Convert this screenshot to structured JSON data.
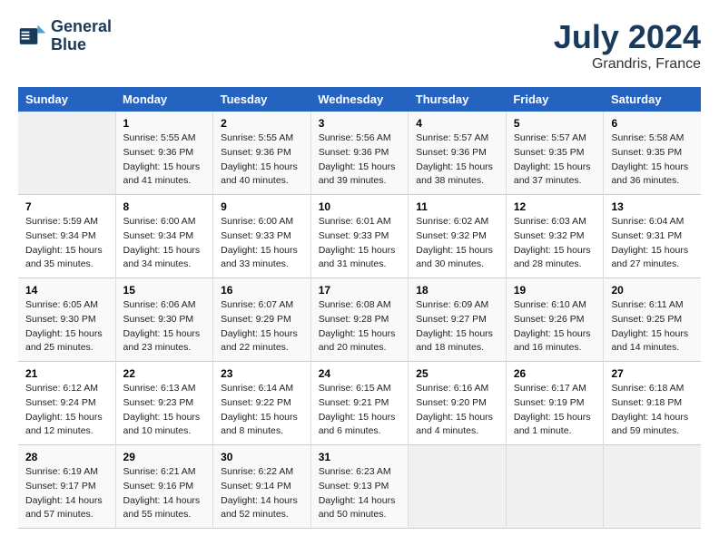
{
  "header": {
    "logo_line1": "General",
    "logo_line2": "Blue",
    "title": "July 2024",
    "subtitle": "Grandris, France"
  },
  "calendar": {
    "days_of_week": [
      "Sunday",
      "Monday",
      "Tuesday",
      "Wednesday",
      "Thursday",
      "Friday",
      "Saturday"
    ],
    "weeks": [
      [
        {
          "day": "",
          "details": ""
        },
        {
          "day": "1",
          "details": "Sunrise: 5:55 AM\nSunset: 9:36 PM\nDaylight: 15 hours\nand 41 minutes."
        },
        {
          "day": "2",
          "details": "Sunrise: 5:55 AM\nSunset: 9:36 PM\nDaylight: 15 hours\nand 40 minutes."
        },
        {
          "day": "3",
          "details": "Sunrise: 5:56 AM\nSunset: 9:36 PM\nDaylight: 15 hours\nand 39 minutes."
        },
        {
          "day": "4",
          "details": "Sunrise: 5:57 AM\nSunset: 9:36 PM\nDaylight: 15 hours\nand 38 minutes."
        },
        {
          "day": "5",
          "details": "Sunrise: 5:57 AM\nSunset: 9:35 PM\nDaylight: 15 hours\nand 37 minutes."
        },
        {
          "day": "6",
          "details": "Sunrise: 5:58 AM\nSunset: 9:35 PM\nDaylight: 15 hours\nand 36 minutes."
        }
      ],
      [
        {
          "day": "7",
          "details": "Sunrise: 5:59 AM\nSunset: 9:34 PM\nDaylight: 15 hours\nand 35 minutes."
        },
        {
          "day": "8",
          "details": "Sunrise: 6:00 AM\nSunset: 9:34 PM\nDaylight: 15 hours\nand 34 minutes."
        },
        {
          "day": "9",
          "details": "Sunrise: 6:00 AM\nSunset: 9:33 PM\nDaylight: 15 hours\nand 33 minutes."
        },
        {
          "day": "10",
          "details": "Sunrise: 6:01 AM\nSunset: 9:33 PM\nDaylight: 15 hours\nand 31 minutes."
        },
        {
          "day": "11",
          "details": "Sunrise: 6:02 AM\nSunset: 9:32 PM\nDaylight: 15 hours\nand 30 minutes."
        },
        {
          "day": "12",
          "details": "Sunrise: 6:03 AM\nSunset: 9:32 PM\nDaylight: 15 hours\nand 28 minutes."
        },
        {
          "day": "13",
          "details": "Sunrise: 6:04 AM\nSunset: 9:31 PM\nDaylight: 15 hours\nand 27 minutes."
        }
      ],
      [
        {
          "day": "14",
          "details": "Sunrise: 6:05 AM\nSunset: 9:30 PM\nDaylight: 15 hours\nand 25 minutes."
        },
        {
          "day": "15",
          "details": "Sunrise: 6:06 AM\nSunset: 9:30 PM\nDaylight: 15 hours\nand 23 minutes."
        },
        {
          "day": "16",
          "details": "Sunrise: 6:07 AM\nSunset: 9:29 PM\nDaylight: 15 hours\nand 22 minutes."
        },
        {
          "day": "17",
          "details": "Sunrise: 6:08 AM\nSunset: 9:28 PM\nDaylight: 15 hours\nand 20 minutes."
        },
        {
          "day": "18",
          "details": "Sunrise: 6:09 AM\nSunset: 9:27 PM\nDaylight: 15 hours\nand 18 minutes."
        },
        {
          "day": "19",
          "details": "Sunrise: 6:10 AM\nSunset: 9:26 PM\nDaylight: 15 hours\nand 16 minutes."
        },
        {
          "day": "20",
          "details": "Sunrise: 6:11 AM\nSunset: 9:25 PM\nDaylight: 15 hours\nand 14 minutes."
        }
      ],
      [
        {
          "day": "21",
          "details": "Sunrise: 6:12 AM\nSunset: 9:24 PM\nDaylight: 15 hours\nand 12 minutes."
        },
        {
          "day": "22",
          "details": "Sunrise: 6:13 AM\nSunset: 9:23 PM\nDaylight: 15 hours\nand 10 minutes."
        },
        {
          "day": "23",
          "details": "Sunrise: 6:14 AM\nSunset: 9:22 PM\nDaylight: 15 hours\nand 8 minutes."
        },
        {
          "day": "24",
          "details": "Sunrise: 6:15 AM\nSunset: 9:21 PM\nDaylight: 15 hours\nand 6 minutes."
        },
        {
          "day": "25",
          "details": "Sunrise: 6:16 AM\nSunset: 9:20 PM\nDaylight: 15 hours\nand 4 minutes."
        },
        {
          "day": "26",
          "details": "Sunrise: 6:17 AM\nSunset: 9:19 PM\nDaylight: 15 hours\nand 1 minute."
        },
        {
          "day": "27",
          "details": "Sunrise: 6:18 AM\nSunset: 9:18 PM\nDaylight: 14 hours\nand 59 minutes."
        }
      ],
      [
        {
          "day": "28",
          "details": "Sunrise: 6:19 AM\nSunset: 9:17 PM\nDaylight: 14 hours\nand 57 minutes."
        },
        {
          "day": "29",
          "details": "Sunrise: 6:21 AM\nSunset: 9:16 PM\nDaylight: 14 hours\nand 55 minutes."
        },
        {
          "day": "30",
          "details": "Sunrise: 6:22 AM\nSunset: 9:14 PM\nDaylight: 14 hours\nand 52 minutes."
        },
        {
          "day": "31",
          "details": "Sunrise: 6:23 AM\nSunset: 9:13 PM\nDaylight: 14 hours\nand 50 minutes."
        },
        {
          "day": "",
          "details": ""
        },
        {
          "day": "",
          "details": ""
        },
        {
          "day": "",
          "details": ""
        }
      ]
    ]
  }
}
